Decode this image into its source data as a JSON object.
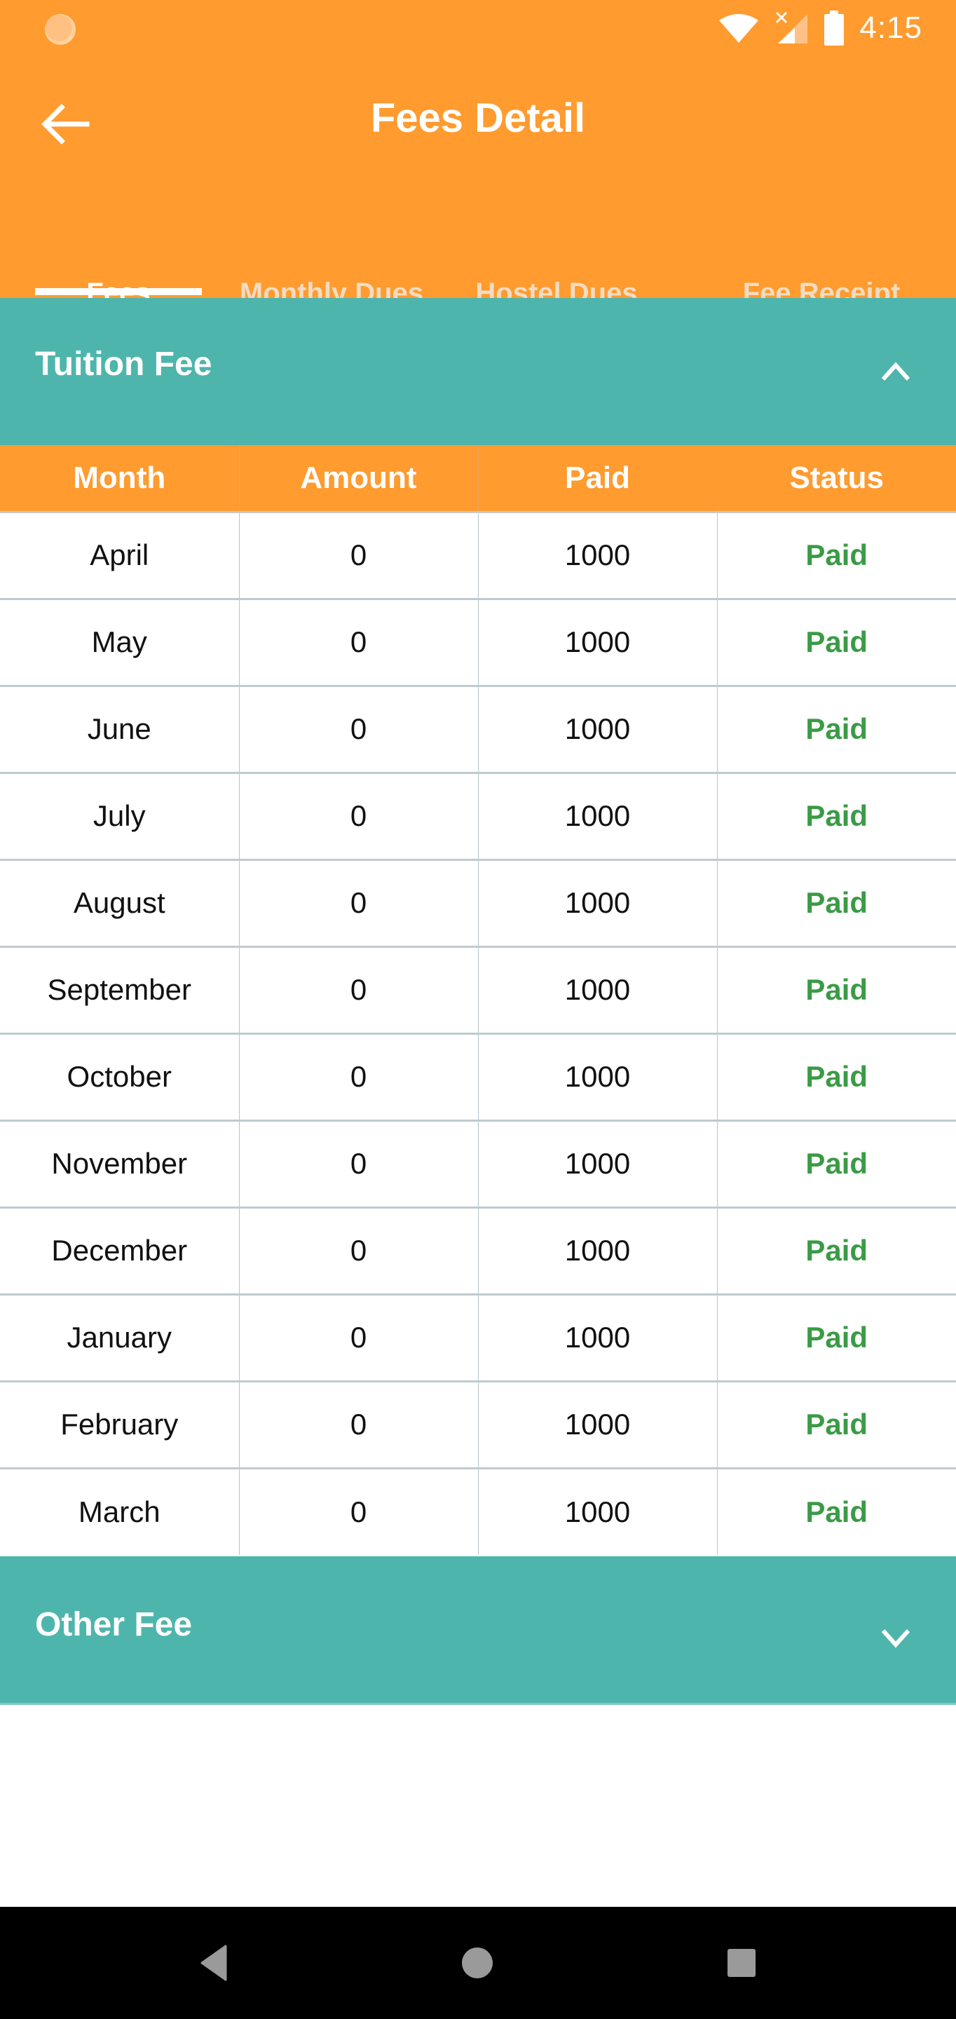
{
  "status_bar": {
    "time": "4:15",
    "icons": [
      "notification-app-icon",
      "wifi-icon",
      "signal-no-sim-icon",
      "battery-icon"
    ]
  },
  "app_bar": {
    "title": "Fees Detail",
    "back_icon": "arrow-left-icon"
  },
  "tabs": [
    {
      "label": "Fees",
      "active": true
    },
    {
      "label": "Monthly Dues",
      "active": false
    },
    {
      "label": "Hostel Dues",
      "active": false
    },
    {
      "label": "Fee Receipt",
      "active": false
    }
  ],
  "sections": {
    "tuition": {
      "title": "Tuition Fee",
      "expanded": true,
      "icon": "chevron-up-icon"
    },
    "other": {
      "title": "Other Fee",
      "expanded": false,
      "icon": "chevron-down-icon"
    }
  },
  "table": {
    "columns": [
      "Month",
      "Amount",
      "Paid",
      "Status"
    ],
    "rows": [
      {
        "month": "April",
        "amount": "0",
        "paid": "1000",
        "status": "Paid"
      },
      {
        "month": "May",
        "amount": "0",
        "paid": "1000",
        "status": "Paid"
      },
      {
        "month": "June",
        "amount": "0",
        "paid": "1000",
        "status": "Paid"
      },
      {
        "month": "July",
        "amount": "0",
        "paid": "1000",
        "status": "Paid"
      },
      {
        "month": "August",
        "amount": "0",
        "paid": "1000",
        "status": "Paid"
      },
      {
        "month": "September",
        "amount": "0",
        "paid": "1000",
        "status": "Paid"
      },
      {
        "month": "October",
        "amount": "0",
        "paid": "1000",
        "status": "Paid"
      },
      {
        "month": "November",
        "amount": "0",
        "paid": "1000",
        "status": "Paid"
      },
      {
        "month": "December",
        "amount": "0",
        "paid": "1000",
        "status": "Paid"
      },
      {
        "month": "January",
        "amount": "0",
        "paid": "1000",
        "status": "Paid"
      },
      {
        "month": "February",
        "amount": "0",
        "paid": "1000",
        "status": "Paid"
      },
      {
        "month": "March",
        "amount": "0",
        "paid": "1000",
        "status": "Paid"
      }
    ]
  },
  "colors": {
    "primary": "#FF9B2F",
    "section": "#4EB5AC",
    "status_paid": "#3A9B45",
    "tab_inactive": "#F3DCC2"
  },
  "nav_bar": {
    "buttons": [
      "nav-back-icon",
      "nav-home-icon",
      "nav-recents-icon"
    ]
  }
}
